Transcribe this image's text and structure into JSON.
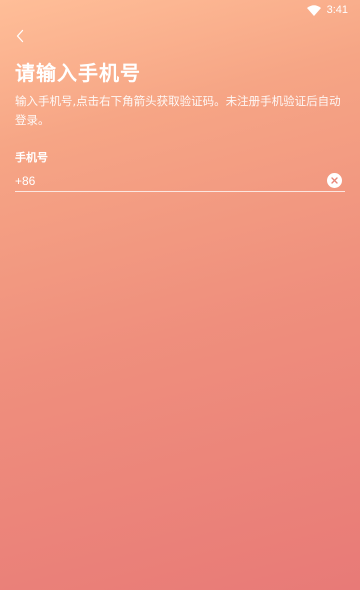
{
  "status_bar": {
    "time": "3:41",
    "icons": [
      "wifi-icon"
    ]
  },
  "header": {
    "back_icon": "chevron-left-icon"
  },
  "title": "请输入手机号",
  "description": "输入手机号,点击右下角箭头获取验证码。未注册手机验证后自动登录。",
  "phone": {
    "label": "手机号",
    "value": "+86",
    "clear_icon": "clear-circle-icon"
  },
  "colors": {
    "gradient_top": "#ffbe98",
    "gradient_bottom": "#e87a77",
    "text": "#ffffff"
  }
}
